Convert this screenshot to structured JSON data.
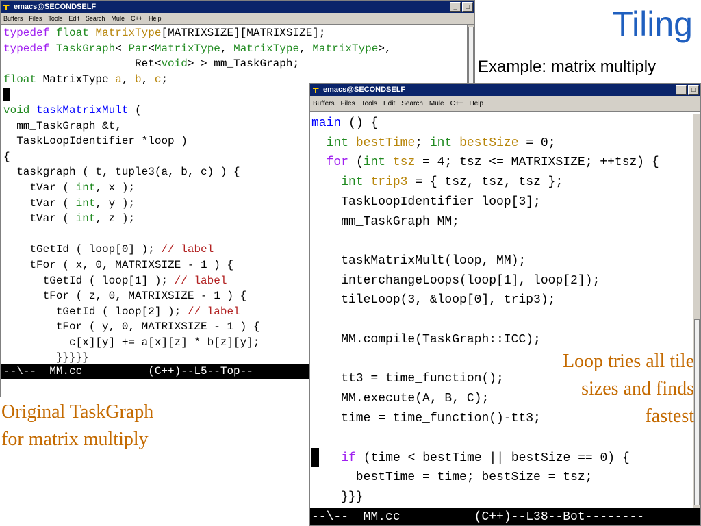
{
  "slide": {
    "title": "Tiling",
    "subtitle": "Example: matrix multiply",
    "note_left": [
      "Original TaskGraph",
      "for matrix multiply"
    ],
    "note_right": [
      "Loop tries all tile",
      "sizes and finds",
      "fastest"
    ]
  },
  "window1": {
    "title": "emacs@SECONDSELF",
    "menu": [
      "Buffers",
      "Files",
      "Tools",
      "Edit",
      "Search",
      "Mule",
      "C++",
      "Help"
    ],
    "modeline": "--\\--  MM.cc          (C++)--L5--Top--"
  },
  "window2": {
    "title": "emacs@SECONDSELF",
    "menu": [
      "Buffers",
      "Files",
      "Tools",
      "Edit",
      "Search",
      "Mule",
      "C++",
      "Help"
    ],
    "modeline": "--\\--  MM.cc          (C++)--L38--Bot--------"
  },
  "colors": {
    "keyword": "#a020f0",
    "type": "#228b22",
    "function": "#0000ff",
    "variable": "#b8860b",
    "comment": "#b22222",
    "title_blue": "#1f5fbf",
    "note_orange": "#c46a00"
  },
  "icons": [
    "emacs-logo-icon",
    "minimize-icon",
    "maximize-icon"
  ]
}
